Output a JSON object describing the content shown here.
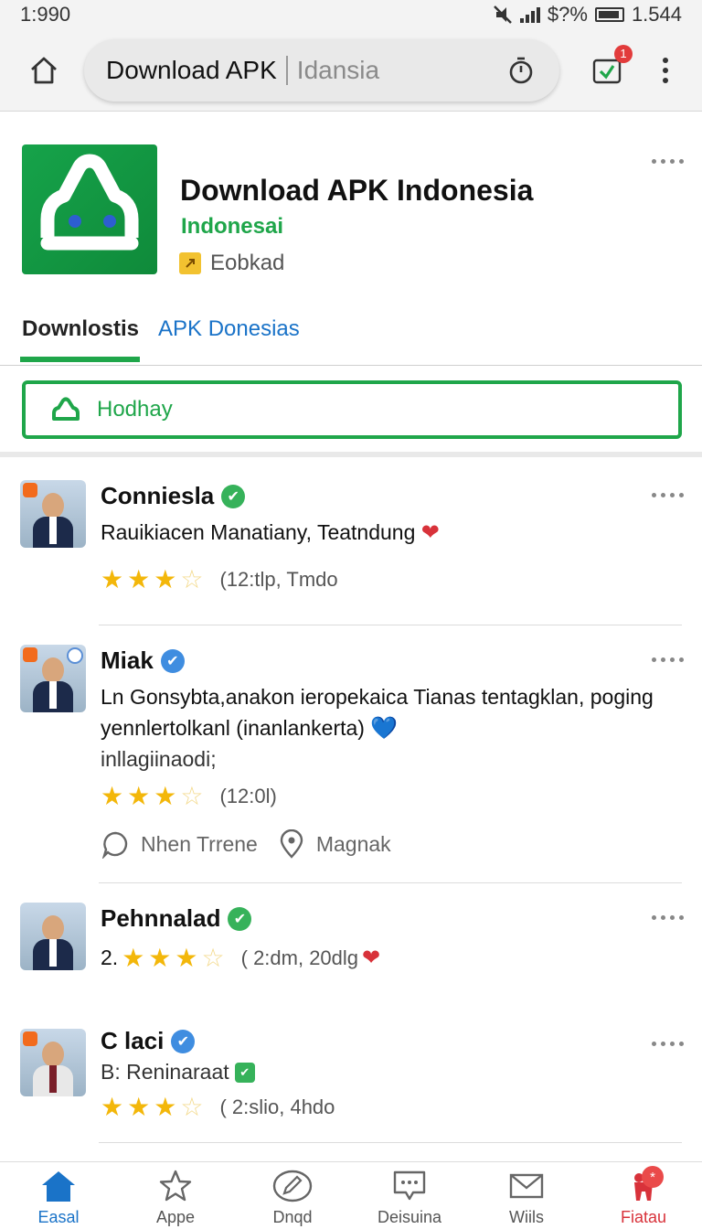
{
  "status": {
    "time": "1:990",
    "right_text": "$?%",
    "battery_text": "1.544"
  },
  "browser": {
    "url_text": "Download APK",
    "url_suffix": "Idansia",
    "ext_badge": "1"
  },
  "app": {
    "title": "Download APK Indonesia",
    "developer": "Indonesai",
    "category": "Eobkad"
  },
  "tabs": [
    {
      "label": "Downlostis"
    },
    {
      "label": "APK Donesias"
    }
  ],
  "filter": {
    "label": "Hodhay"
  },
  "reviews": [
    {
      "name": "Conniesla",
      "badge": "green",
      "text": "Rauikiacen Manatiany, Teatndung",
      "emoji": "❤",
      "rating": 3.5,
      "meta": "(12:tlp, Tmdo"
    },
    {
      "name": "Miak",
      "badge": "blue",
      "text": "Ln Gonsybta,anakon ieropekaica Tianas tentagklan, poging yennlertolkanl (inanlankerta)",
      "emoji": "💙",
      "text2": "inllagiinaodi;",
      "rating": 3.5,
      "meta": "(12:0l)",
      "actions": [
        "Nhen Trrene",
        "Magnak"
      ]
    },
    {
      "name": "Pehnnalad",
      "badge": "green",
      "prefix": "2.",
      "rating": 3.5,
      "meta": "( 2:dm, 20dlg",
      "emoji": "❤"
    },
    {
      "name": "C laci",
      "badge": "blue",
      "sub": "B: Reninaraat",
      "rating": 3.5,
      "meta": "( 2:slio, 4hdo"
    }
  ],
  "bottom_nav": [
    {
      "label": "Easal",
      "icon": "home-icon",
      "state": "active"
    },
    {
      "label": "Appe",
      "icon": "star-icon",
      "state": ""
    },
    {
      "label": "Dnqd",
      "icon": "edit-icon",
      "state": ""
    },
    {
      "label": "Deisuina",
      "icon": "chat-icon",
      "state": ""
    },
    {
      "label": "Wiils",
      "icon": "mail-icon",
      "state": ""
    },
    {
      "label": "Fiatau",
      "icon": "gift-icon",
      "state": "alert",
      "badge": "*"
    }
  ],
  "colors": {
    "brand_green": "#1fa64a",
    "link_blue": "#1a73c8",
    "star": "#f3b70a",
    "alert_red": "#d8323a"
  }
}
